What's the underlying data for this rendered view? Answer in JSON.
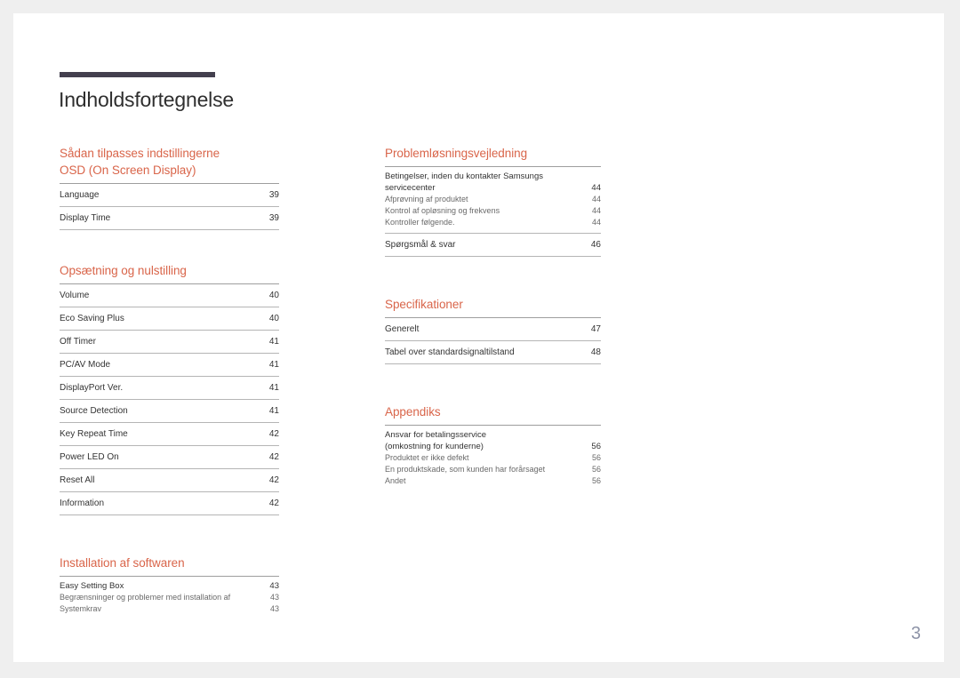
{
  "document": {
    "title": "Indholdsfortegnelse",
    "page_number": "3",
    "accent_color": "#d9654a",
    "rule_color": "#433f4e",
    "page_number_color": "#8e94a8"
  },
  "columns": {
    "left": [
      {
        "heading": "Sådan tilpasses indstillingerne\nOSD (On Screen Display)",
        "heading_line1": "Sådan tilpasses indstillingerne",
        "heading_line2": "OSD (On Screen Display)",
        "entries": [
          {
            "label": "Language",
            "page": "39"
          },
          {
            "label": "Display Time",
            "page": "39"
          }
        ]
      },
      {
        "heading_line1": "Opsætning og nulstilling",
        "heading_line2": "",
        "entries": [
          {
            "label": "Volume",
            "page": "40"
          },
          {
            "label": "Eco Saving Plus",
            "page": "40"
          },
          {
            "label": "Off Timer",
            "page": "41"
          },
          {
            "label": "PC/AV Mode",
            "page": "41"
          },
          {
            "label": "DisplayPort Ver.",
            "page": "41"
          },
          {
            "label": "Source Detection",
            "page": "41"
          },
          {
            "label": "Key Repeat Time",
            "page": "42"
          },
          {
            "label": "Power LED On",
            "page": "42"
          },
          {
            "label": "Reset All",
            "page": "42"
          },
          {
            "label": "Information",
            "page": "42"
          }
        ]
      },
      {
        "heading_line1": "Installation af softwaren",
        "heading_line2": "",
        "subentries": [
          {
            "label": "Easy Setting Box",
            "page": "43",
            "strong": true
          },
          {
            "label": "Begrænsninger og problemer med installation af",
            "page": "43",
            "strong": false
          },
          {
            "label": "Systemkrav",
            "page": "43",
            "strong": false
          }
        ]
      }
    ],
    "right": [
      {
        "heading_line1": "Problemløsningsvejledning",
        "heading_line2": "",
        "subentries": [
          {
            "label": "Betingelser, inden du kontakter Samsungs",
            "page": "",
            "strong": true
          },
          {
            "label": "servicecenter",
            "page": "44",
            "strong": true
          },
          {
            "label": "Afprøvning af produktet",
            "page": "44",
            "strong": false
          },
          {
            "label": "Kontrol af opløsning og frekvens",
            "page": "44",
            "strong": false
          },
          {
            "label": "Kontroller følgende.",
            "page": "44",
            "strong": false
          }
        ],
        "entries": [
          {
            "label": "Spørgsmål & svar",
            "page": "46"
          }
        ]
      },
      {
        "heading_line1": "Specifikationer",
        "heading_line2": "",
        "entries": [
          {
            "label": "Generelt",
            "page": "47"
          },
          {
            "label": "Tabel over standardsignaltilstand",
            "page": "48"
          }
        ]
      },
      {
        "heading_line1": "Appendiks",
        "heading_line2": "",
        "subentries": [
          {
            "label": "Ansvar for betalingsservice",
            "page": "",
            "strong": true
          },
          {
            "label": "(omkostning for kunderne)",
            "page": "56",
            "strong": true
          },
          {
            "label": "Produktet er ikke defekt",
            "page": "56",
            "strong": false
          },
          {
            "label": "En produktskade, som kunden har forårsaget",
            "page": "56",
            "strong": false
          },
          {
            "label": "Andet",
            "page": "56",
            "strong": false
          }
        ]
      }
    ]
  }
}
